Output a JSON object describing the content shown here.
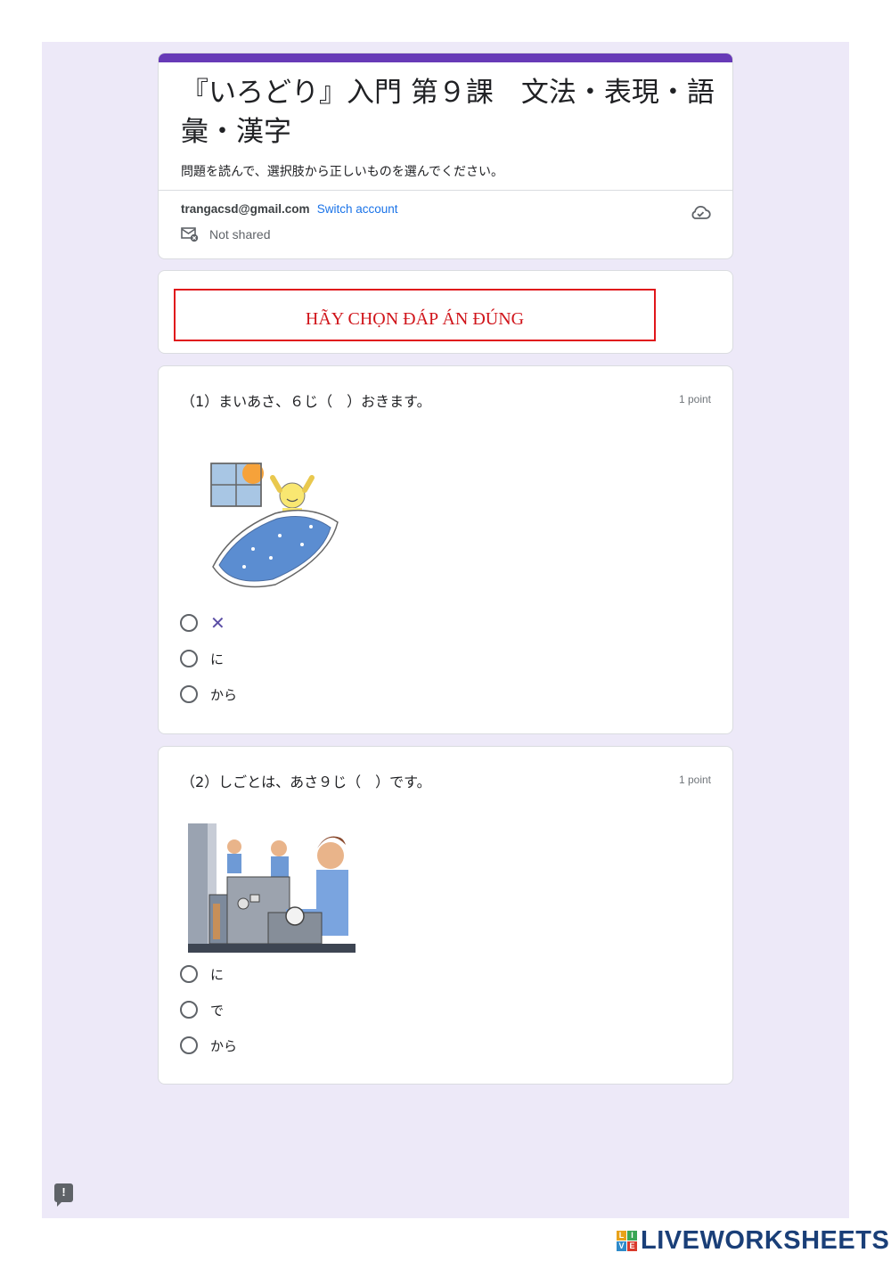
{
  "form": {
    "title": "『いろどり』入門 第９課　文法・表現・語彙・漢字",
    "description": "問題を読んで、選択肢から正しいものを選んでください。",
    "account_email": "trangacsd@gmail.com",
    "switch_account": "Switch account",
    "shared_status": "Not shared",
    "accent_color": "#673ab7",
    "background_color": "#ede9f8"
  },
  "notice": {
    "text": "HÃY CHỌN ĐÁP ÁN ĐÚNG",
    "color": "#e0161b"
  },
  "questions": [
    {
      "text": "（1）まいあさ、６じ（　）おきます。",
      "points": "1 point",
      "image": "person-waking-up-illustration",
      "options": [
        "✕",
        "に",
        "から"
      ]
    },
    {
      "text": "（2）しごとは、あさ９じ（　）です。",
      "points": "1 point",
      "image": "factory-workers-illustration",
      "options": [
        "に",
        "で",
        "から"
      ]
    }
  ],
  "footer": {
    "brand": "LIVEWORKSHEETS",
    "brand_blocks": [
      "L",
      "I",
      "V",
      "E"
    ]
  }
}
